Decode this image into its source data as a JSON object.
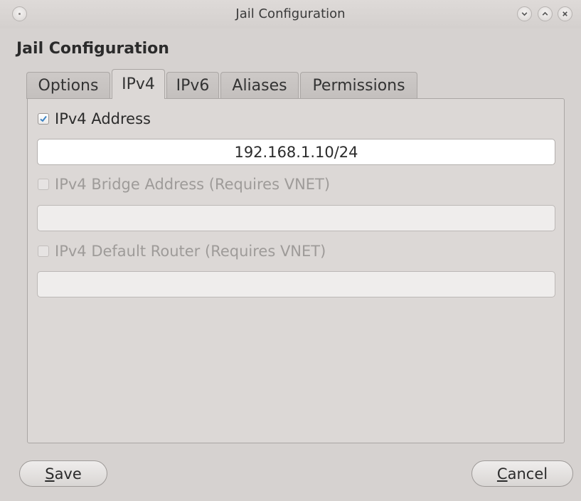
{
  "window": {
    "title": "Jail Configuration",
    "heading": "Jail Configuration"
  },
  "tabs": [
    {
      "label": "Options",
      "active": false
    },
    {
      "label": "IPv4",
      "active": true
    },
    {
      "label": "IPv6",
      "active": false
    },
    {
      "label": "Aliases",
      "active": false
    },
    {
      "label": "Permissions",
      "active": false
    }
  ],
  "ipv4": {
    "address": {
      "label": "IPv4 Address",
      "checked": true,
      "value": "192.168.1.10/24"
    },
    "bridge": {
      "label": "IPv4 Bridge Address (Requires VNET)",
      "checked": false,
      "value": ""
    },
    "router": {
      "label": "IPv4 Default Router (Requires VNET)",
      "checked": false,
      "value": ""
    }
  },
  "buttons": {
    "save": {
      "mnemonic": "S",
      "rest": "ave"
    },
    "cancel": {
      "mnemonic": "C",
      "rest": "ancel"
    }
  }
}
